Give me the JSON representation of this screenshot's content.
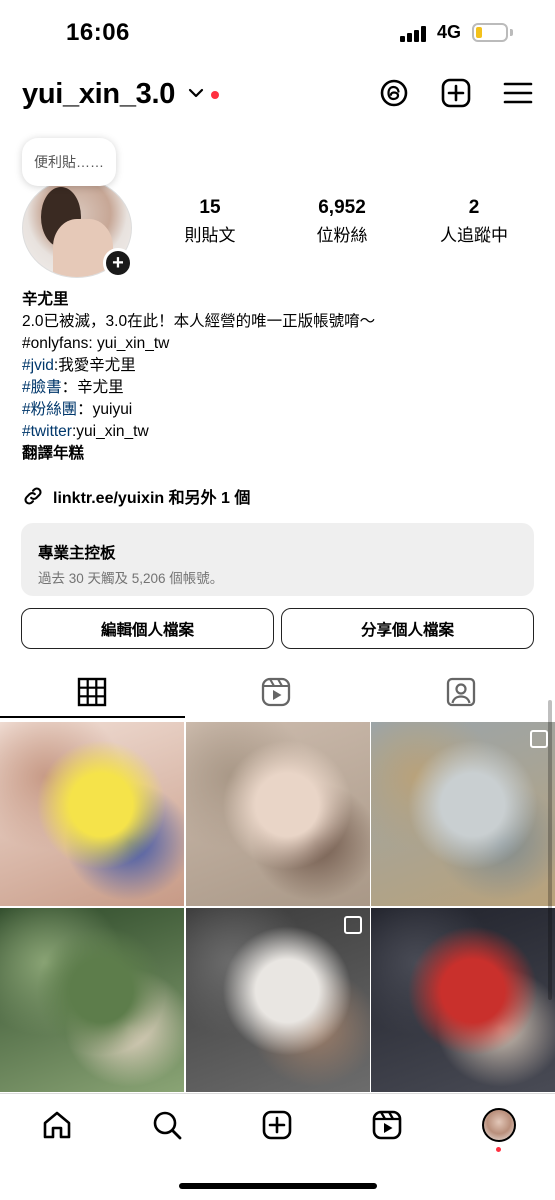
{
  "status_bar": {
    "time": "16:06",
    "network": "4G"
  },
  "header": {
    "username": "yui_xin_3.0"
  },
  "note": {
    "text": "便利貼……"
  },
  "stats": [
    {
      "value": "15",
      "label": "則貼文"
    },
    {
      "value": "6,952",
      "label": "位粉絲"
    },
    {
      "value": "2",
      "label": "人追蹤中"
    }
  ],
  "bio": {
    "name": "辛尤里",
    "line1": "2.0已被滅，3.0在此！本人經營的唯一正版帳號唷～",
    "line2": "#onlyfans: yui_xin_tw",
    "line3_tag": "#jvid",
    "line3_text": ":我愛辛尤里",
    "line4_tag": "#臉書",
    "line4_text": "：辛尤里",
    "line5_tag": "#粉絲團",
    "line5_text": "：yuiyui",
    "line6_tag": "#twitter",
    "line6_text": ":yui_xin_tw",
    "line7": "翻譯年糕"
  },
  "link": {
    "text": "linktr.ee/yuixin 和另外 1 個"
  },
  "dashboard": {
    "title": "專業主控板",
    "subtitle": "過去 30 天觸及 5,206 個帳號。"
  },
  "buttons": {
    "edit": "編輯個人檔案",
    "share": "分享個人檔案"
  },
  "grid_posts": [
    {
      "colors": [
        "#f1dfd6",
        "#f5e34a",
        "#2f4da8",
        "#c79a86"
      ],
      "multi": false
    },
    {
      "colors": [
        "#cdbcae",
        "#e9d5c7",
        "#6b5346",
        "#a99887"
      ],
      "multi": false
    },
    {
      "colors": [
        "#9aa5ab",
        "#c9cfd1",
        "#7d8a8f",
        "#b9a27a"
      ],
      "multi": true
    },
    {
      "colors": [
        "#2e4a2a",
        "#5d7d4b",
        "#f0dccd",
        "#8aa475"
      ],
      "multi": false
    },
    {
      "colors": [
        "#3a3a3a",
        "#e9e6e2",
        "#a07f69",
        "#6c6c6c"
      ],
      "multi": true
    },
    {
      "colors": [
        "#20222b",
        "#c9302c",
        "#d8c8b8",
        "#494b55"
      ],
      "multi": false
    }
  ]
}
